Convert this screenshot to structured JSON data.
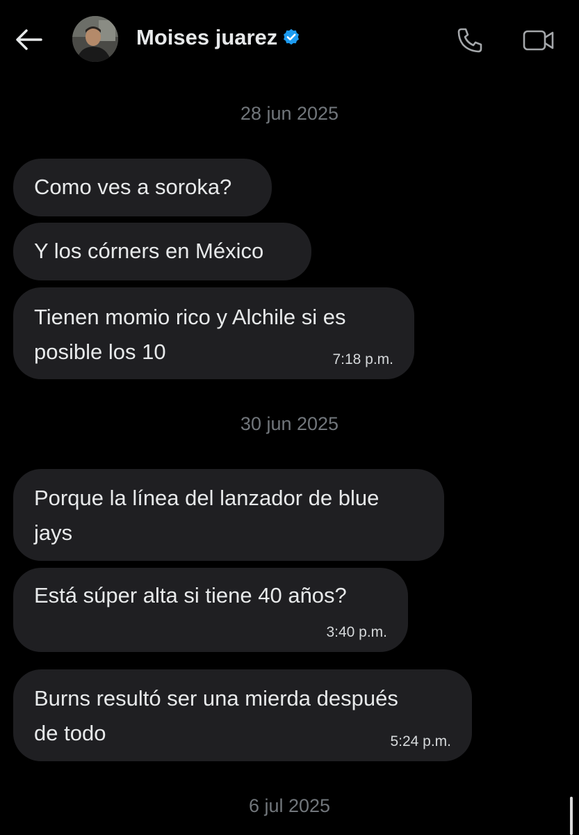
{
  "header": {
    "contact_name": "Moises juarez",
    "verified": true,
    "icons": {
      "back": "arrow-left-icon",
      "call": "phone-icon",
      "video": "video-camera-icon",
      "verified": "verified-badge-icon"
    }
  },
  "colors": {
    "background": "#000000",
    "bubble": "#1f1f22",
    "text": "#e7e9ea",
    "muted": "#71767b",
    "verified_blue": "#1d9bf0"
  },
  "conversation": {
    "date_1": "28 jun 2025",
    "date_2": "30 jun 2025",
    "date_3": "6 jul 2025",
    "messages": [
      {
        "text": "Como ves a soroka?",
        "time": ""
      },
      {
        "text": "Y los córners en México",
        "time": ""
      },
      {
        "text": "Tienen momio rico y Alchile si es\nposible los 10",
        "time": "7:18 p.m."
      },
      {
        "text": "Porque la línea del lanzador de blue\njays",
        "time": ""
      },
      {
        "text": "Está súper alta si tiene 40 años?",
        "time": "3:40 p.m."
      },
      {
        "text": "Burns resultó ser una mierda después\nde todo",
        "time": "5:24 p.m."
      }
    ]
  }
}
